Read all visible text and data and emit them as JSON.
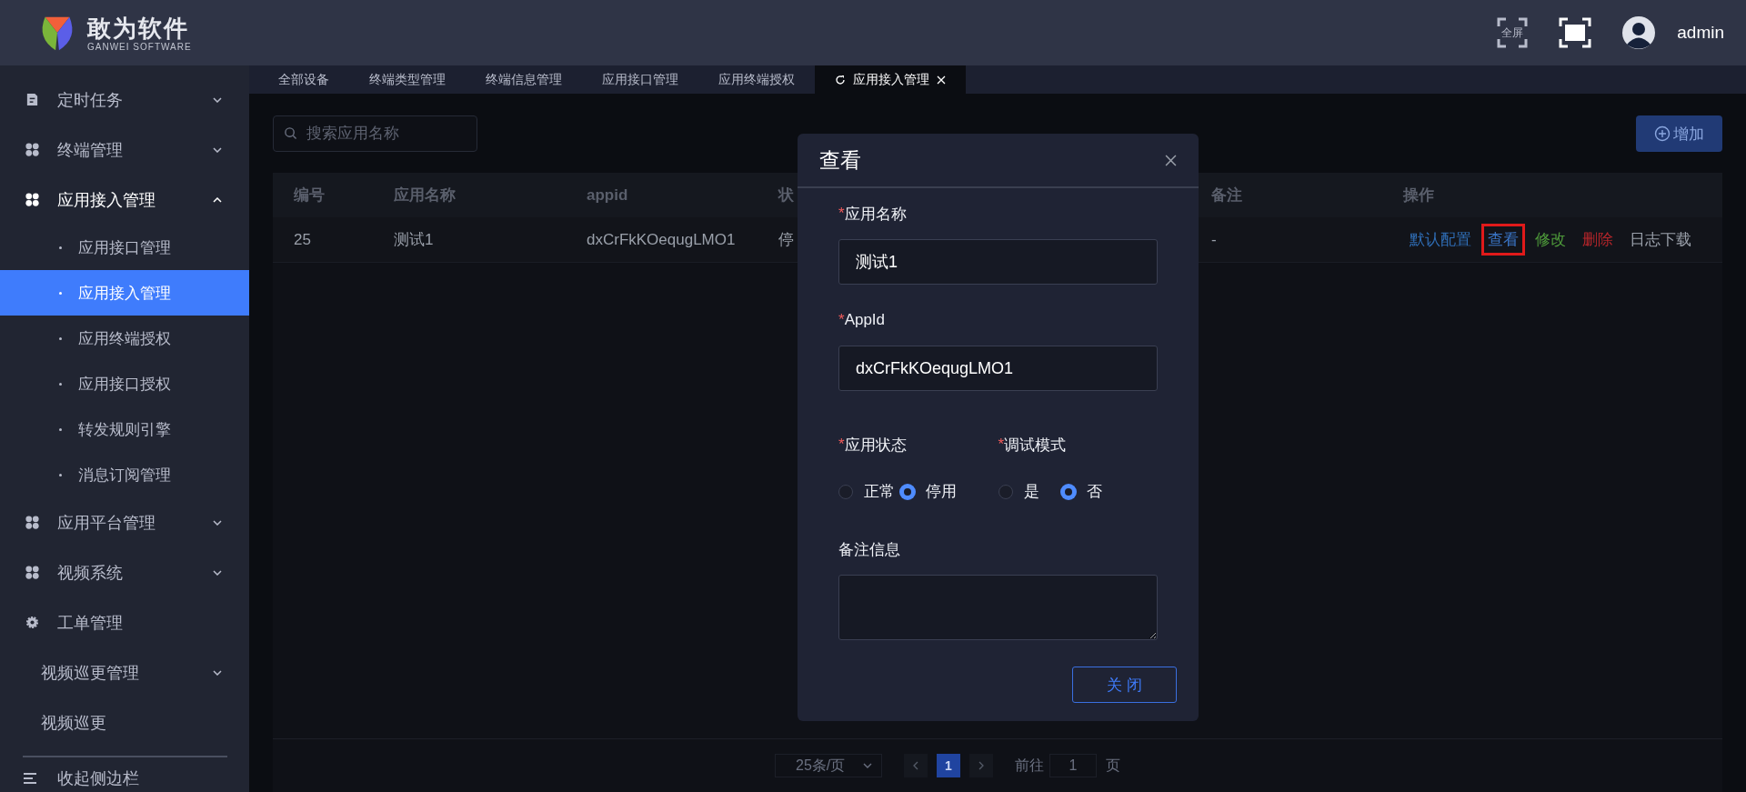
{
  "header": {
    "logo_title": "敢为软件",
    "logo_subtitle": "GANWEI SOFTWARE",
    "fullscreen_label": "全屏",
    "username": "admin"
  },
  "sidebar": {
    "items": [
      {
        "label": "定时任务",
        "expanded": false
      },
      {
        "label": "终端管理",
        "expanded": false
      },
      {
        "label": "应用接入管理",
        "expanded": true,
        "children": [
          {
            "label": "应用接口管理",
            "selected": false
          },
          {
            "label": "应用接入管理",
            "selected": true
          },
          {
            "label": "应用终端授权",
            "selected": false
          },
          {
            "label": "应用接口授权",
            "selected": false
          },
          {
            "label": "转发规则引擎",
            "selected": false
          },
          {
            "label": "消息订阅管理",
            "selected": false
          }
        ]
      },
      {
        "label": "应用平台管理",
        "expanded": false
      },
      {
        "label": "视频系统",
        "expanded": false
      },
      {
        "label": "工单管理"
      },
      {
        "label": "视频巡更管理",
        "expanded": false
      },
      {
        "label": "视频巡更"
      }
    ],
    "collapse_label": "收起侧边栏"
  },
  "tabs": [
    {
      "label": "全部设备",
      "selected": false
    },
    {
      "label": "终端类型管理",
      "selected": false
    },
    {
      "label": "终端信息管理",
      "selected": false
    },
    {
      "label": "应用接口管理",
      "selected": false
    },
    {
      "label": "应用终端授权",
      "selected": false
    },
    {
      "label": "应用接入管理",
      "selected": true
    }
  ],
  "search": {
    "placeholder": "搜索应用名称"
  },
  "add_button": "增加",
  "table": {
    "columns": [
      "编号",
      "应用名称",
      "appid",
      "状",
      "备注",
      "操作"
    ],
    "rows": [
      {
        "cells": [
          "25",
          "测试1",
          "dxCrFkKOequgLMO1",
          "停",
          "-"
        ],
        "actions": [
          {
            "label": "默认配置",
            "kind": "config",
            "highlighted": false
          },
          {
            "label": "查看",
            "kind": "view",
            "highlighted": true
          },
          {
            "label": "修改",
            "kind": "edit",
            "highlighted": false
          },
          {
            "label": "删除",
            "kind": "delete",
            "highlighted": false
          },
          {
            "label": "日志下载",
            "kind": "download",
            "highlighted": false
          }
        ]
      }
    ]
  },
  "pagination": {
    "page_size": "25条/页",
    "pages": [
      {
        "label": "1",
        "selected": true
      }
    ],
    "goto_label": "前往",
    "goto_value": "1",
    "page_suffix": "页"
  },
  "dialog": {
    "title": "查看",
    "required_mark": "*",
    "fields": [
      {
        "label": "应用名称",
        "required": true,
        "value": "测试1"
      },
      {
        "label": "AppId",
        "required": true,
        "value": "dxCrFkKOequgLMO1"
      }
    ],
    "radio_groups": [
      {
        "label": "应用状态",
        "required": true,
        "options": [
          {
            "label": "正常",
            "selected": false
          },
          {
            "label": "停用",
            "selected": true
          }
        ]
      },
      {
        "label": "调试模式",
        "required": true,
        "options": [
          {
            "label": "是",
            "selected": false
          },
          {
            "label": "否",
            "selected": true
          }
        ]
      }
    ],
    "notes": {
      "label": "备注信息",
      "required": false
    },
    "close_button": "关 闭"
  }
}
